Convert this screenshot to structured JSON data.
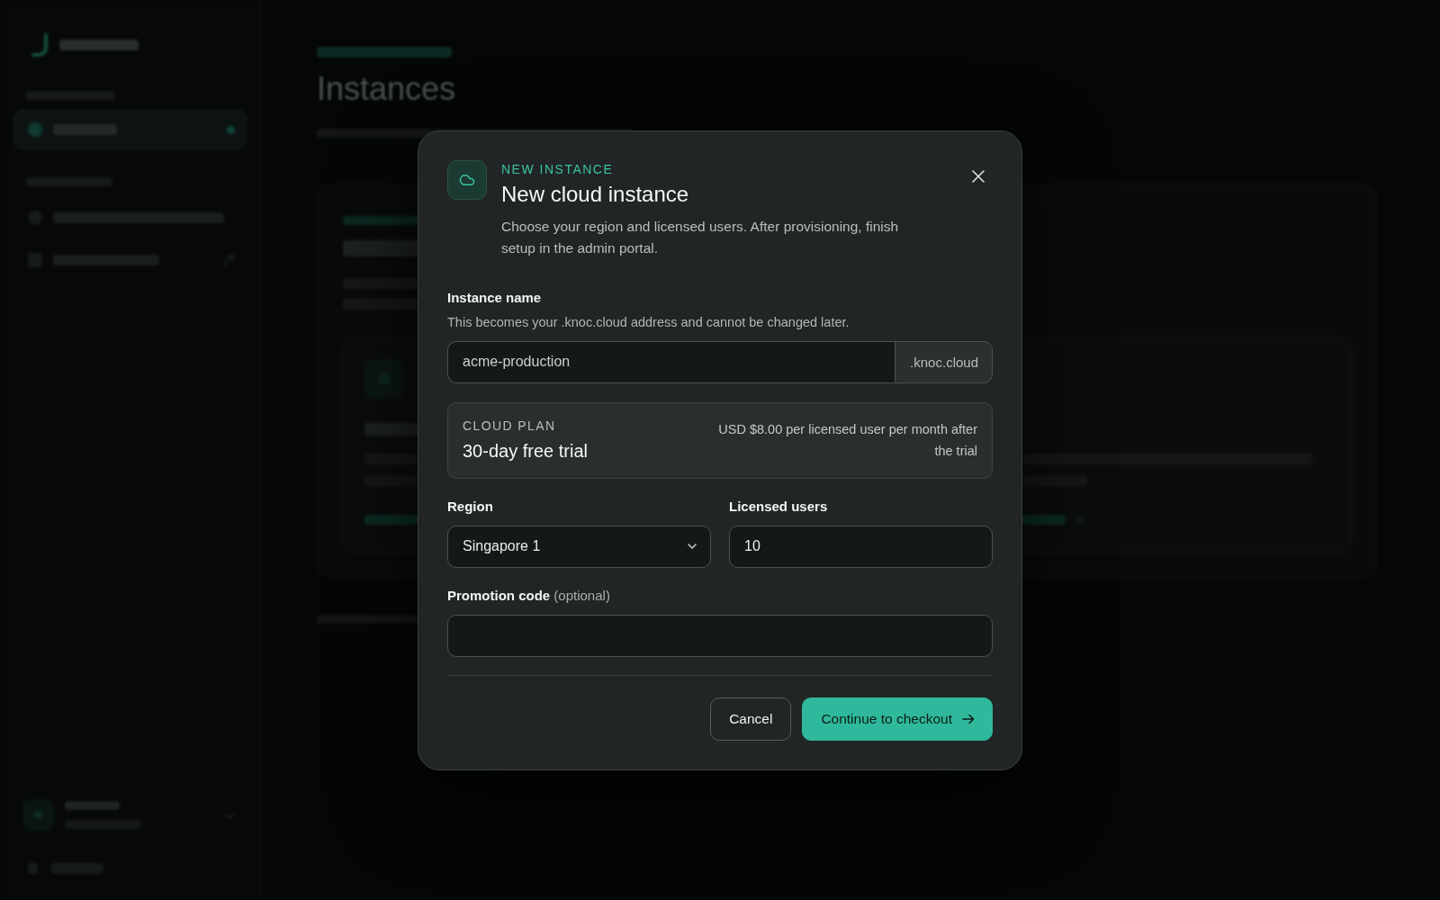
{
  "backdrop": {
    "sidebar": {
      "sections": [
        {
          "items": [
            {
              "kind": "page",
              "selected": true
            }
          ]
        },
        {
          "items": [
            {
              "kind": "page",
              "selected": false
            },
            {
              "kind": "external",
              "selected": false
            }
          ]
        }
      ]
    },
    "page": {
      "heading": "Instances"
    }
  },
  "dialog": {
    "eyebrow": "NEW INSTANCE",
    "title": "New cloud instance",
    "description": "Choose your region and licensed users. After provisioning, finish setup in the admin portal.",
    "instance_name": {
      "label": "Instance name",
      "hint": "This becomes your .knoc.cloud address and cannot be changed later.",
      "value": "acme-production",
      "suffix": ".knoc.cloud"
    },
    "plan": {
      "label": "CLOUD PLAN",
      "name": "30-day free trial",
      "price_note": "USD $8.00 per licensed user per month after the trial"
    },
    "region": {
      "label": "Region",
      "value": "Singapore 1"
    },
    "licensed_users": {
      "label": "Licensed users",
      "value": "10"
    },
    "promotion_code": {
      "label": "**Promotion code** (optional)"
    },
    "buttons": [
      {
        "label": "Cancel",
        "kind": "secondary"
      },
      {
        "label": "Continue to checkout",
        "kind": "primary"
      }
    ]
  }
}
